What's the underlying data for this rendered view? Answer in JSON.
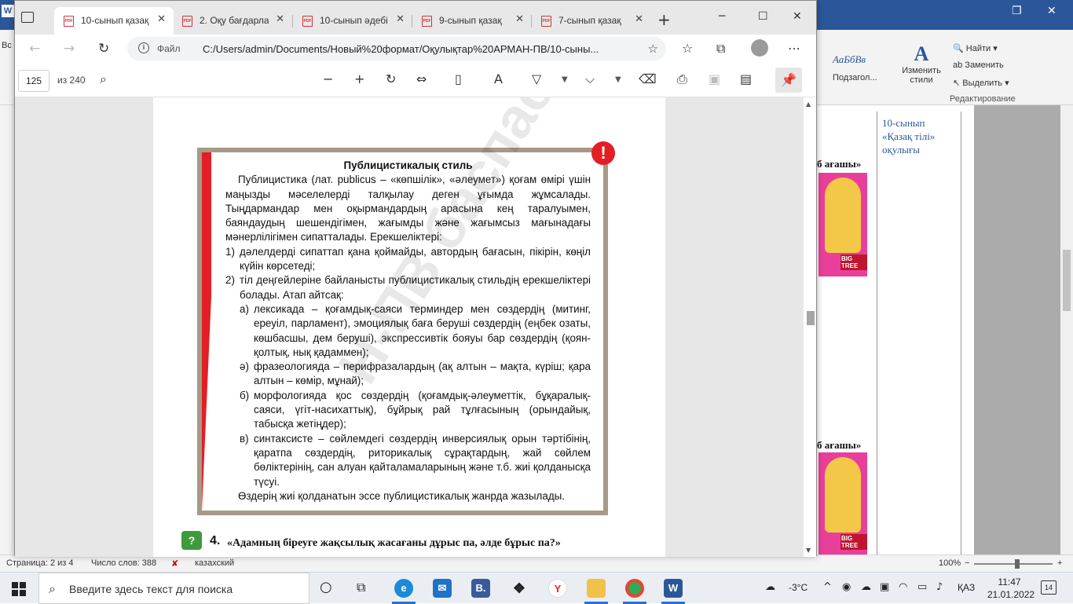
{
  "word": {
    "ribbon_fragment": "Вс",
    "style_preview": "АаБбВв",
    "styles_label": "Подзагол...",
    "change_styles": [
      "Изменить",
      "стили"
    ],
    "edit_items": [
      "Найти",
      "Заменить",
      "Выделить"
    ],
    "edit_group_label": "Редактирование",
    "comment_text": [
      "10-сынып",
      "«Қазақ тілі»",
      "оқулығы"
    ],
    "cover_caption": "б ағашы»",
    "cover_tag": "BIG TREE",
    "status": {
      "page": "Страница: 2 из 4",
      "words": "Число слов: 388",
      "language": "казахский",
      "zoom": "100%"
    }
  },
  "edge": {
    "tabs": [
      {
        "title": "10-сынып қазақ",
        "active": true
      },
      {
        "title": "2. Оқу бағдарла",
        "active": false
      },
      {
        "title": "10-сынып әдебі",
        "active": false
      },
      {
        "title": "9-сынып қазақ",
        "active": false
      },
      {
        "title": "7-сынып қазақ",
        "active": false
      }
    ],
    "address": {
      "label": "Файл",
      "url": "C:/Users/admin/Documents/Новый%20формат/Оқулықтар%20АРМАН-ПВ/10-сыны..."
    },
    "pdf": {
      "page_current": "125",
      "page_total": "из 240"
    }
  },
  "book": {
    "title": "Публицистикалық стиль",
    "intro": "Публицистика (лат. publicus – «көпшілік», «әлеумет») қоғам өмірі үшін маңызды мәселелерді талқылау деген ұғымда жұмсалады. Тыңдармандар мен оқырмандардың арасына кең таралуымен, баяндаудың шешендігімен, жағымды және жағымсыз мағынадағы мәнерлілігімен сипатталады. Ерекшеліктері:",
    "items": [
      {
        "num": "1)",
        "text": "дәлелдерді сипаттап қана қоймайды, автордың бағасын, пікірін, көңіл күйін көрсетеді;"
      },
      {
        "num": "2)",
        "text": "тіл деңгейлеріне байланысты публицистикалық стильдің ерекшеліктері болады. Атап айтсақ:"
      }
    ],
    "subitems": [
      {
        "num": "а)",
        "text": "лексикада – қоғамдық-саяси терминдер мен сөздердің (митинг, ереуіл, парламент), эмоциялық баға беруші сөздердің (еңбек озаты, көшбасшы, дем беруші), экспрессивтік бояуы бар сөздердің (қоян-қолтық, нық қадаммен);"
      },
      {
        "num": "ә)",
        "text": "фразеологияда – перифразалардың (ақ алтын – мақта, күріш; қара алтын – көмір, мұнай);"
      },
      {
        "num": "б)",
        "text": "морфологияда қос сөздердің (қоғамдық-әлеуметтік, бұқаралық-саяси, үгіт-насихаттық), бұйрық рай тұлғасының (орындайық, табысқа жетіңдер);"
      },
      {
        "num": "в)",
        "text": "синтаксисте – сөйлемдегі сөздердің инверсиялық орын тәртібінің, қаратпа сөздердің, риторикалық сұрақтардың, жай сөйлем бөліктерінің, сан алуан қайталамаларының және т.б. жиі қолданысқа түсуі."
      }
    ],
    "closing": "Өздерің жиі қолданатын эссе публицистикалық жанрда жазылады.",
    "question": {
      "number": "4.",
      "text": "«Адамның біреуге жақсылық жасағаны дұрыс па, әлде бұрыс па?»"
    },
    "watermark": "Н-ПВ баспасы"
  },
  "taskbar": {
    "search_placeholder": "Введите здесь текст для поиска",
    "temperature": "-3°C",
    "language": "ҚАЗ",
    "time": "11:47",
    "date": "21.01.2022",
    "notifications": "14"
  }
}
